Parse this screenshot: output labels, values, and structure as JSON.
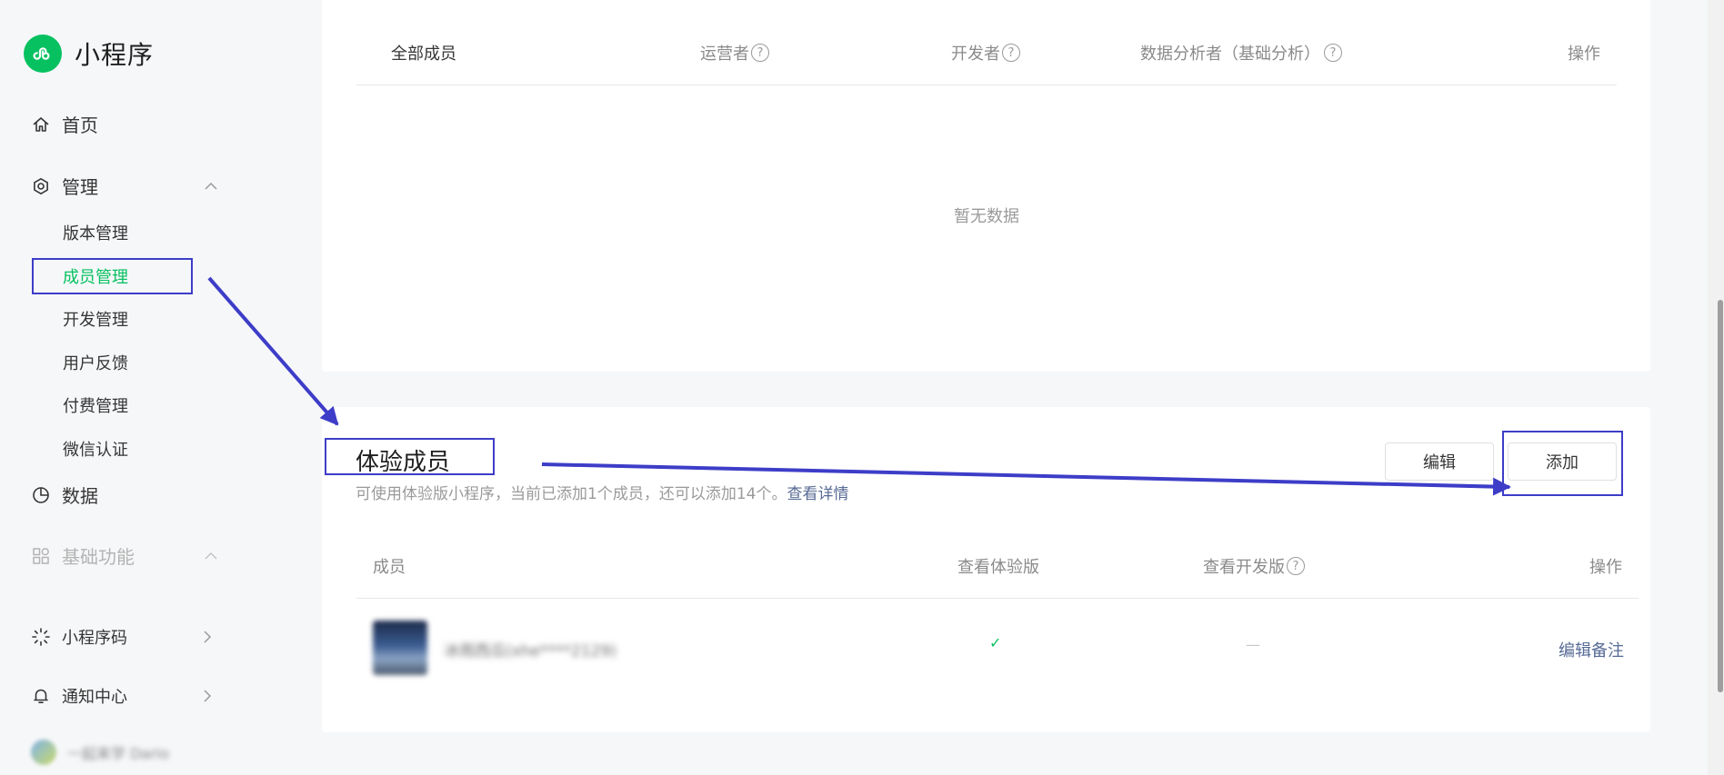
{
  "app": {
    "title": "小程序"
  },
  "sidebar": {
    "home": "首页",
    "manage": {
      "label": "管理",
      "items": [
        {
          "label": "版本管理"
        },
        {
          "label": "成员管理"
        },
        {
          "label": "开发管理"
        },
        {
          "label": "用户反馈"
        },
        {
          "label": "付费管理"
        },
        {
          "label": "微信认证"
        }
      ]
    },
    "data": "数据",
    "basic": "基础功能",
    "bottom": [
      {
        "label": "小程序码"
      },
      {
        "label": "通知中心"
      }
    ],
    "user": {
      "name": "一起来学 Dario"
    }
  },
  "admin_table": {
    "columns": [
      "全部成员",
      "运营者",
      "开发者",
      "数据分析者（基础分析）",
      "操作"
    ],
    "empty": "暂无数据"
  },
  "trial_members": {
    "title": "体验成员",
    "description": "可使用体验版小程序，当前已添加1个成员，还可以添加14个。",
    "link": "查看详情",
    "edit_button": "编辑",
    "add_button": "添加",
    "columns": [
      "成员",
      "查看体验版",
      "查看开发版",
      "操作"
    ],
    "rows": [
      {
        "member": "冰雨西瓜(xhe****2129)",
        "view_trial": "✓",
        "view_dev": "—",
        "action": "编辑备注"
      }
    ]
  },
  "colors": {
    "accent": "#07c160",
    "link": "#576b95",
    "annotation": "#3d3dc8"
  }
}
